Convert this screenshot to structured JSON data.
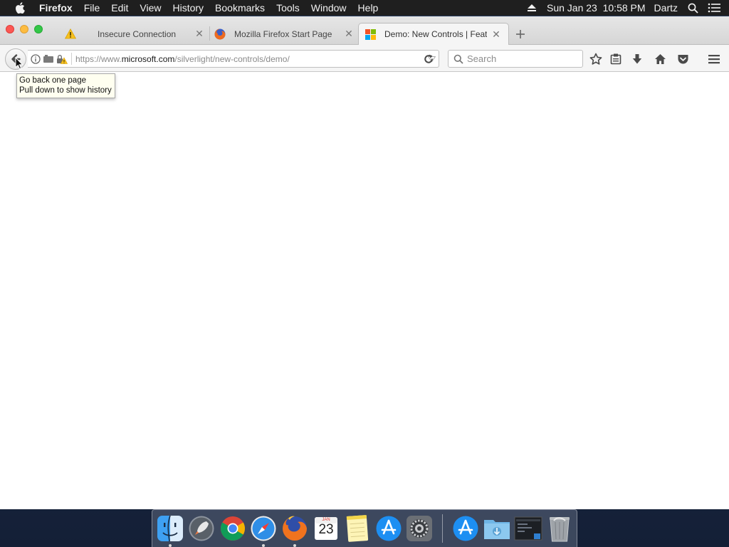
{
  "menubar": {
    "app_name": "Firefox",
    "menus": [
      "File",
      "Edit",
      "View",
      "History",
      "Bookmarks",
      "Tools",
      "Window",
      "Help"
    ],
    "datetime": "Sun Jan 23  10:58 PM",
    "user": "Dartz"
  },
  "tabs": [
    {
      "title": "Insecure Connection",
      "icon": "warning-icon"
    },
    {
      "title": "Mozilla Firefox Start Page",
      "icon": "firefox-icon"
    },
    {
      "title": "Demo: New Controls | Feat...",
      "icon": "microsoft-icon",
      "active": true
    }
  ],
  "navbar": {
    "url_prefix": "https://www.",
    "url_domain": "microsoft.com",
    "url_path": "/silverlight/new-controls/demo/",
    "search_placeholder": "Search"
  },
  "tooltip": {
    "line1": "Go back one page",
    "line2": "Pull down to show history"
  },
  "dock": {
    "apps": [
      "finder-icon",
      "launchpad-icon",
      "chrome-icon",
      "safari-icon",
      "firefox-icon",
      "calendar-icon",
      "notes-icon",
      "app-store-icon",
      "system-preferences-icon"
    ],
    "calendar_month": "JAN",
    "calendar_day": "23"
  },
  "colors": {
    "traffic_close": "#fc5753",
    "traffic_minimize": "#fdbc40",
    "traffic_maximize": "#33c748",
    "tooltip_bg": "#fffff0",
    "menubar_bg": "#1f1f1f"
  }
}
